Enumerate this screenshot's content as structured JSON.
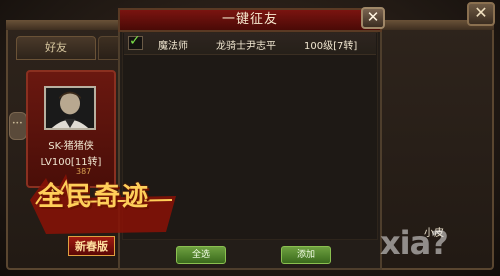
{
  "dialog": {
    "title": "一键征友",
    "close_icon": "close-icon",
    "rows": [
      {
        "checked": true,
        "class": "魔法师",
        "name": "龙骑士尹志平",
        "level": "100级[7转]"
      }
    ],
    "buttons": {
      "select_all": "全选",
      "add": "添加"
    }
  },
  "background_panel": {
    "tab_friends": "好友",
    "player_card": {
      "name": "SK-猪猪侠",
      "level": "LV100[11转]",
      "extra": "387"
    },
    "right_player_name": "小皮"
  },
  "logo": {
    "main": "全民奇迹",
    "sub": "新春版"
  },
  "watermark": "xia?",
  "colors": {
    "title_bar": "#7a1410",
    "button_green": "#6ea040",
    "check_green": "#7ce04a",
    "card_red": "#6a1810"
  }
}
